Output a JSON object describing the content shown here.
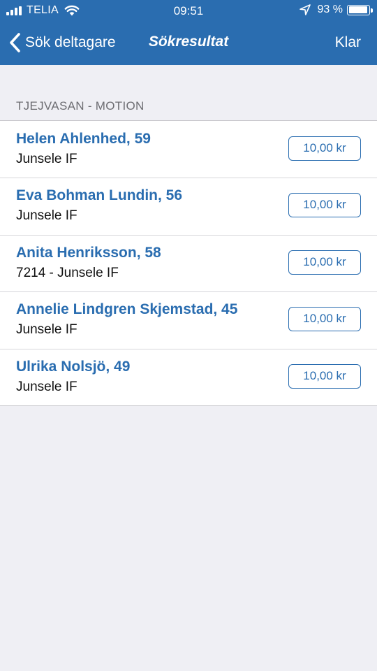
{
  "status_bar": {
    "carrier": "TELIA",
    "time": "09:51",
    "battery_percent": "93 %",
    "battery_level": 0.93,
    "signal_bars": 4
  },
  "nav": {
    "back_label": "Sök deltagare",
    "title": "Sökresultat",
    "done_label": "Klar"
  },
  "section": {
    "title": "TJEJVASAN - MOTION"
  },
  "results": [
    {
      "name": "Helen Ahlenhed, 59",
      "club": "Junsele IF",
      "price": "10,00 kr"
    },
    {
      "name": "Eva Bohman Lundin, 56",
      "club": "Junsele IF",
      "price": "10,00 kr"
    },
    {
      "name": "Anita Henriksson, 58",
      "club": "7214 - Junsele IF",
      "price": "10,00 kr"
    },
    {
      "name": "Annelie Lindgren Skjemstad, 45",
      "club": "Junsele IF",
      "price": "10,00 kr"
    },
    {
      "name": "Ulrika Nolsjö, 49",
      "club": "Junsele IF",
      "price": "10,00 kr"
    }
  ],
  "colors": {
    "brand": "#2a6db0",
    "background": "#efeff4"
  }
}
